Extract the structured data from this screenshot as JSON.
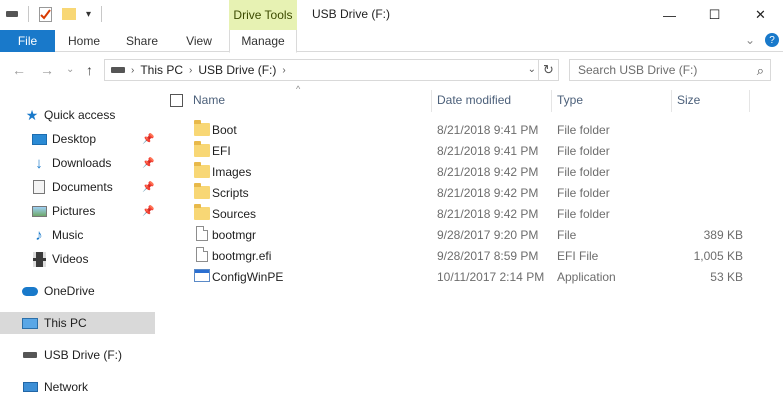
{
  "window": {
    "title": "USB Drive (F:)",
    "context_tab_group": "Drive Tools",
    "controls": {
      "minimize": "—",
      "maximize": "☐",
      "close": "✕"
    }
  },
  "ribbon": {
    "tabs": [
      {
        "label": "File"
      },
      {
        "label": "Home"
      },
      {
        "label": "Share"
      },
      {
        "label": "View"
      },
      {
        "label": "Manage"
      }
    ],
    "expand_glyph": "⌄",
    "help_glyph": "?"
  },
  "address": {
    "back": "←",
    "forward": "→",
    "recent": "⌄",
    "up": "↑",
    "crumbs": [
      "This PC",
      "USB Drive (F:)"
    ],
    "search_placeholder": "Search USB Drive (F:)"
  },
  "nav": {
    "items": [
      {
        "label": "Quick access",
        "icon": "star-icon"
      },
      {
        "label": "Desktop",
        "icon": "desktop-icon",
        "pinned": true
      },
      {
        "label": "Downloads",
        "icon": "download-arrow-icon",
        "pinned": true
      },
      {
        "label": "Documents",
        "icon": "documents-icon",
        "pinned": true
      },
      {
        "label": "Pictures",
        "icon": "pictures-icon",
        "pinned": true
      },
      {
        "label": "Music",
        "icon": "music-note-icon"
      },
      {
        "label": "Videos",
        "icon": "film-icon"
      },
      {
        "label": "OneDrive",
        "icon": "cloud-icon"
      },
      {
        "label": "This PC",
        "icon": "monitor-icon",
        "selected": true
      },
      {
        "label": "USB Drive (F:)",
        "icon": "usb-drive-icon"
      },
      {
        "label": "Network",
        "icon": "network-icon"
      }
    ]
  },
  "columns": {
    "name": "Name",
    "date": "Date modified",
    "type": "Type",
    "size": "Size"
  },
  "files": [
    {
      "name": "Boot",
      "date": "8/21/2018 9:41 PM",
      "type": "File folder",
      "size": "",
      "kind": "folder"
    },
    {
      "name": "EFI",
      "date": "8/21/2018 9:41 PM",
      "type": "File folder",
      "size": "",
      "kind": "folder"
    },
    {
      "name": "Images",
      "date": "8/21/2018 9:42 PM",
      "type": "File folder",
      "size": "",
      "kind": "folder"
    },
    {
      "name": "Scripts",
      "date": "8/21/2018 9:42 PM",
      "type": "File folder",
      "size": "",
      "kind": "folder"
    },
    {
      "name": "Sources",
      "date": "8/21/2018 9:42 PM",
      "type": "File folder",
      "size": "",
      "kind": "folder"
    },
    {
      "name": "bootmgr",
      "date": "9/28/2017 9:20 PM",
      "type": "File",
      "size": "389 KB",
      "kind": "file"
    },
    {
      "name": "bootmgr.efi",
      "date": "9/28/2017 8:59 PM",
      "type": "EFI File",
      "size": "1,005 KB",
      "kind": "file"
    },
    {
      "name": "ConfigWinPE",
      "date": "10/11/2017 2:14 PM",
      "type": "Application",
      "size": "53 KB",
      "kind": "app"
    }
  ]
}
